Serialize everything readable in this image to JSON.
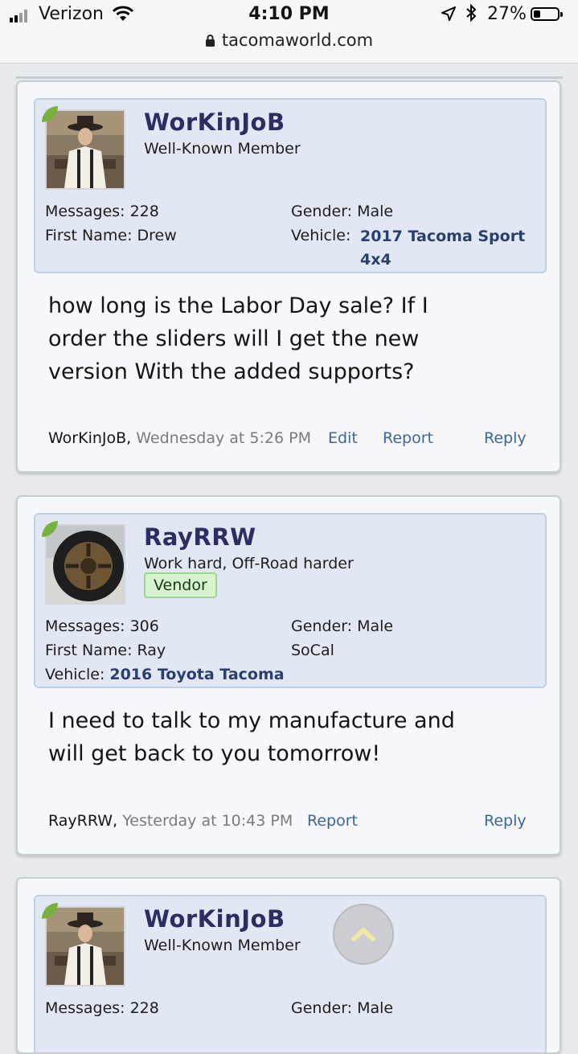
{
  "status_bar": {
    "carrier": "Verizon",
    "time": "4:10 PM",
    "battery": "27%",
    "battery_level": 0.27,
    "url": "tacomaworld.com"
  },
  "posts": [
    {
      "username": "WorKinJoB",
      "title": "Well-Known Member",
      "stats": {
        "messages_label": "Messages:",
        "messages": "228",
        "first_name_label": "First Name:",
        "first_name": "Drew",
        "gender_label": "Gender:",
        "gender": "Male",
        "vehicle_label": "Vehicle:",
        "vehicle_line1": "2017 Tacoma Sport",
        "vehicle_line2": "4x4"
      },
      "message_lines": [
        "how long is the Labor Day sale? If I",
        "order the sliders will I get the new",
        "version With the added supports?"
      ],
      "footer": {
        "author": "WorKinJoB,",
        "date": "Wednesday at 5:26 PM",
        "edit": "Edit",
        "report": "Report",
        "reply": "Reply"
      }
    },
    {
      "username": "RayRRW",
      "title": "Work hard, Off-Road harder",
      "badge": "Vendor",
      "stats": {
        "messages_label": "Messages:",
        "messages": "306",
        "first_name_label": "First Name:",
        "first_name": "Ray",
        "gender_label": "Gender:",
        "gender": "Male",
        "location": "SoCal",
        "vehicle_label": "Vehicle:",
        "vehicle": "2016 Toyota Tacoma"
      },
      "message_lines": [
        "I need to talk to my manufacture and",
        "will get back to you tomorrow!"
      ],
      "footer": {
        "author": "RayRRW,",
        "date": "Yesterday at 10:43 PM",
        "report": "Report",
        "reply": "Reply"
      }
    },
    {
      "username": "WorKinJoB",
      "title": "Well-Known Member",
      "stats": {
        "messages_label": "Messages:",
        "messages": "228",
        "gender_label": "Gender:",
        "gender": "Male"
      }
    }
  ]
}
